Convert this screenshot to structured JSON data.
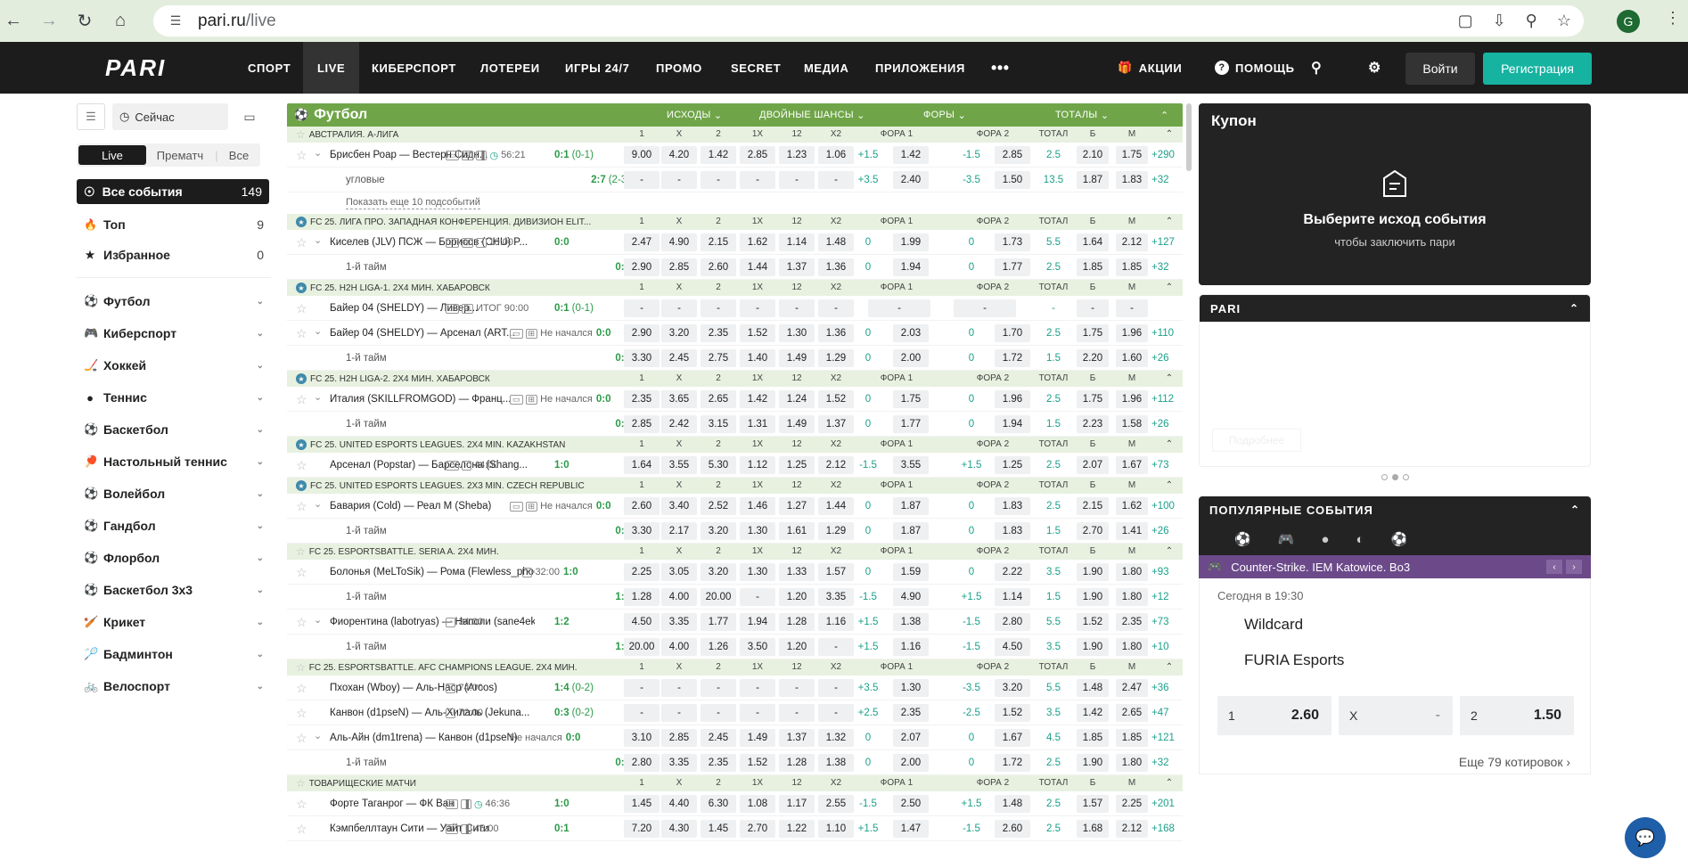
{
  "browser": {
    "url_host": "pari.ru",
    "url_path": "/live",
    "profile_initial": "G"
  },
  "nav": {
    "items": [
      "СПОРТ",
      "LIVE",
      "КИБЕРСПОРТ",
      "ЛОТЕРЕИ",
      "ИГРЫ 24/7",
      "ПРОМО",
      "SECRET",
      "МЕДИА",
      "ПРИЛОЖЕНИЯ"
    ],
    "active": "LIVE",
    "promo": "АКЦИИ",
    "help": "ПОМОЩЬ",
    "login": "Войти",
    "register": "Регистрация",
    "logo_text": "PARI"
  },
  "left": {
    "time_label": "Сейчас",
    "segments": [
      "Live",
      "Прематч",
      "Все"
    ],
    "all_events": {
      "label": "Все события",
      "count": "149"
    },
    "quick": [
      {
        "label": "Топ",
        "count": "9",
        "icon": "fire-icon"
      },
      {
        "label": "Избранное",
        "count": "0",
        "icon": "star-icon"
      }
    ],
    "sports": [
      {
        "label": "Футбол",
        "icon": "football-icon"
      },
      {
        "label": "Киберспорт",
        "icon": "gamepad-icon"
      },
      {
        "label": "Хоккей",
        "icon": "hockey-icon"
      },
      {
        "label": "Теннис",
        "icon": "tennis-icon"
      },
      {
        "label": "Баскетбол",
        "icon": "basketball-icon"
      },
      {
        "label": "Настольный теннис",
        "icon": "table-tennis-icon"
      },
      {
        "label": "Волейбол",
        "icon": "volleyball-icon"
      },
      {
        "label": "Гандбол",
        "icon": "handball-icon"
      },
      {
        "label": "Флорбол",
        "icon": "floorball-icon"
      },
      {
        "label": "Баскетбол 3x3",
        "icon": "basketball3x3-icon"
      },
      {
        "label": "Крикет",
        "icon": "cricket-icon"
      },
      {
        "label": "Бадминтон",
        "icon": "badminton-icon"
      },
      {
        "label": "Велоспорт",
        "icon": "cycling-icon"
      }
    ]
  },
  "main": {
    "sport": "Футбол",
    "markets": [
      "ИСХОДЫ",
      "ДВОЙНЫЕ ШАНСЫ",
      "ФОРЫ",
      "ТОТАЛЫ"
    ],
    "cols": [
      "1",
      "X",
      "2",
      "1X",
      "12",
      "X2",
      "ФОРА 1",
      "ФОРА 2",
      "ТОТАЛ",
      "Б",
      "М"
    ],
    "show_more": "Показать еще 10 подсобытий",
    "blocks": [
      {
        "league": "АВСТРАЛИЯ. А-ЛИГА",
        "cup": false,
        "rows": [
          {
            "type": "m",
            "exp": true,
            "name": "Брисбен Роар — Вестерн Сидн...",
            "info": "56:21",
            "clock": true,
            "icons": [
              "tv",
              "pitch",
              "stats"
            ],
            "score": "0:1",
            "ht": "(0-1)",
            "o": [
              "9.00",
              "4.20",
              "1.42",
              "2.85",
              "1.23",
              "1.06"
            ],
            "f1": "+1.5",
            "f1v": "1.42",
            "f2": "-1.5",
            "f2v": "2.85",
            "t": "2.5",
            "b": "2.10",
            "m": "1.75",
            "more": "+290"
          },
          {
            "type": "s",
            "name": "угловые",
            "score": "2:7",
            "ht": "(2-3)",
            "o": [
              "-",
              "-",
              "-",
              "-",
              "-",
              "-"
            ],
            "f1": "+3.5",
            "f1v": "2.40",
            "f2": "-3.5",
            "f2v": "1.50",
            "t": "13.5",
            "b": "1.87",
            "m": "1.83",
            "more": "+32"
          },
          {
            "type": "more"
          }
        ]
      },
      {
        "league": "FC 25. ЛИГА ПРО. ЗАПАДНАЯ КОНФЕРЕНЦИЯ. ДИВИЗИОН ELIT...",
        "cup": true,
        "rows": [
          {
            "type": "m",
            "exp": true,
            "name": "Киселев (JLV) ПСЖ — Борисов (CHU) P...",
            "info": "10:00",
            "icons": [
              "tv",
              "pitch",
              "timer"
            ],
            "score": "0:0",
            "o": [
              "2.47",
              "4.90",
              "2.15",
              "1.62",
              "1.14",
              "1.48"
            ],
            "f1": "0",
            "f1v": "1.99",
            "f2": "0",
            "f2v": "1.73",
            "t": "5.5",
            "b": "1.64",
            "m": "2.12",
            "more": "+127"
          },
          {
            "type": "s",
            "name": "1-й тайм",
            "score": "0:0",
            "o": [
              "2.90",
              "2.85",
              "2.60",
              "1.44",
              "1.37",
              "1.36"
            ],
            "f1": "0",
            "f1v": "1.94",
            "f2": "0",
            "f2v": "1.77",
            "t": "2.5",
            "b": "1.85",
            "m": "1.85",
            "more": "+32"
          }
        ]
      },
      {
        "league": "FC 25. H2H LIGA-1. 2X4 МИН. ХАБАРОВСК",
        "cup": true,
        "rows": [
          {
            "type": "m",
            "exp": false,
            "name": "Байер 04 (SHELDY) — Ливер...",
            "info": "ИТОГ  90:00",
            "icons": [
              "tv",
              "pitch"
            ],
            "score": "0:1",
            "ht": "(0-1)",
            "o": [
              "-",
              "-",
              "-",
              "-",
              "-",
              "-"
            ],
            "f1": "",
            "f1v": "-",
            "f2": "",
            "f2v": "-",
            "t": "-",
            "b": "-",
            "m": "-",
            "more": ""
          },
          {
            "type": "m",
            "exp": true,
            "name": "Байер 04 (SHELDY) — Арсенал (ART...",
            "info": "Не начался",
            "icons": [
              "tv",
              "pitch"
            ],
            "score": "0:0",
            "o": [
              "2.90",
              "3.20",
              "2.35",
              "1.52",
              "1.30",
              "1.36"
            ],
            "f1": "0",
            "f1v": "2.03",
            "f2": "0",
            "f2v": "1.70",
            "t": "2.5",
            "b": "1.75",
            "m": "1.96",
            "more": "+110"
          },
          {
            "type": "s",
            "name": "1-й тайм",
            "score": "0:0",
            "o": [
              "3.30",
              "2.45",
              "2.75",
              "1.40",
              "1.49",
              "1.29"
            ],
            "f1": "0",
            "f1v": "2.00",
            "f2": "0",
            "f2v": "1.72",
            "t": "1.5",
            "b": "2.20",
            "m": "1.60",
            "more": "+26"
          }
        ]
      },
      {
        "league": "FC 25. H2H LIGA-2. 2X4 МИН. ХАБАРОВСК",
        "cup": true,
        "rows": [
          {
            "type": "m",
            "exp": true,
            "name": "Италия (SKILLFROMGOD) — Франц...",
            "info": "Не начался",
            "icons": [
              "tv",
              "pitch"
            ],
            "score": "0:0",
            "o": [
              "2.35",
              "3.65",
              "2.65",
              "1.42",
              "1.24",
              "1.52"
            ],
            "f1": "0",
            "f1v": "1.75",
            "f2": "0",
            "f2v": "1.96",
            "t": "2.5",
            "b": "1.75",
            "m": "1.96",
            "more": "+112"
          },
          {
            "type": "s",
            "name": "1-й тайм",
            "score": "0:0",
            "o": [
              "2.85",
              "2.42",
              "3.15",
              "1.31",
              "1.49",
              "1.37"
            ],
            "f1": "0",
            "f1v": "1.77",
            "f2": "0",
            "f2v": "1.94",
            "t": "1.5",
            "b": "2.23",
            "m": "1.58",
            "more": "+26"
          }
        ]
      },
      {
        "league": "FC 25. UNITED ESPORTS LEAGUES. 2X4 MIN. KAZAKHSTAN",
        "cup": true,
        "rows": [
          {
            "type": "m",
            "exp": false,
            "name": "Арсенал (Popstar) — Барселона (Shang...",
            "info": "44:00",
            "icons": [
              "tv",
              "timer"
            ],
            "score": "1:0",
            "o": [
              "1.64",
              "3.55",
              "5.30",
              "1.12",
              "1.25",
              "2.12"
            ],
            "f1": "-1.5",
            "f1v": "3.55",
            "f2": "+1.5",
            "f2v": "1.25",
            "t": "2.5",
            "b": "2.07",
            "m": "1.67",
            "more": "+73"
          }
        ]
      },
      {
        "league": "FC 25. UNITED ESPORTS LEAGUES. 2X3 MIN. CZECH REPUBLIC",
        "cup": true,
        "rows": [
          {
            "type": "m",
            "exp": true,
            "name": "Бавария (Cold) — Реал М (Sheba)",
            "info": "Не начался",
            "icons": [
              "tv",
              "pitch"
            ],
            "score": "0:0",
            "o": [
              "2.60",
              "3.40",
              "2.52",
              "1.46",
              "1.27",
              "1.44"
            ],
            "f1": "0",
            "f1v": "1.87",
            "f2": "0",
            "f2v": "1.83",
            "t": "2.5",
            "b": "2.15",
            "m": "1.62",
            "more": "+100"
          },
          {
            "type": "s",
            "name": "1-й тайм",
            "score": "0:0",
            "o": [
              "3.30",
              "2.17",
              "3.20",
              "1.30",
              "1.61",
              "1.29"
            ],
            "f1": "0",
            "f1v": "1.87",
            "f2": "0",
            "f2v": "1.83",
            "t": "1.5",
            "b": "2.70",
            "m": "1.41",
            "more": "+26"
          }
        ]
      },
      {
        "league": "FC 25. ESPORTSBATTLE. SERIA A. 2X4 МИН.",
        "cup": false,
        "rows": [
          {
            "type": "m",
            "exp": false,
            "name": "Болонья (MeLToSik) — Рома (Flewless_phoenix)",
            "info": "32:00",
            "icons": [
              "timer"
            ],
            "score": "1:0",
            "o": [
              "2.25",
              "3.05",
              "3.20",
              "1.30",
              "1.33",
              "1.57"
            ],
            "f1": "0",
            "f1v": "1.59",
            "f2": "0",
            "f2v": "2.22",
            "t": "3.5",
            "b": "1.90",
            "m": "1.80",
            "more": "+93"
          },
          {
            "type": "s",
            "name": "1-й тайм",
            "score": "1:0",
            "o": [
              "1.28",
              "4.00",
              "20.00",
              "-",
              "1.20",
              "3.35"
            ],
            "f1": "-1.5",
            "f1v": "4.90",
            "f2": "+1.5",
            "f2v": "1.14",
            "t": "1.5",
            "b": "1.90",
            "m": "1.80",
            "more": "+12"
          },
          {
            "type": "m",
            "exp": true,
            "name": "Фиорентина (labotryas) — Наполи (sane4ek8)",
            "info": "34:00",
            "icons": [
              "timer"
            ],
            "score": "1:2",
            "o": [
              "4.50",
              "3.35",
              "1.77",
              "1.94",
              "1.28",
              "1.16"
            ],
            "f1": "+1.5",
            "f1v": "1.38",
            "f2": "-1.5",
            "f2v": "2.80",
            "t": "5.5",
            "b": "1.52",
            "m": "2.35",
            "more": "+73"
          },
          {
            "type": "s",
            "name": "1-й тайм",
            "score": "1:2",
            "o": [
              "20.00",
              "4.00",
              "1.26",
              "3.50",
              "1.20",
              "-"
            ],
            "f1": "+1.5",
            "f1v": "1.16",
            "f2": "-1.5",
            "f2v": "4.50",
            "t": "3.5",
            "b": "1.90",
            "m": "1.80",
            "more": "+10"
          }
        ]
      },
      {
        "league": "FC 25. ESPORTSBATTLE. AFC CHAMPIONS LEAGUE. 2X4 МИН.",
        "cup": false,
        "rows": [
          {
            "type": "m",
            "exp": false,
            "name": "Пхохан (Wboy) — Аль-Наср (Arcos)",
            "info": "74:00",
            "icons": [
              "timer"
            ],
            "score": "1:4",
            "ht": "(0-2)",
            "o": [
              "-",
              "-",
              "-",
              "-",
              "-",
              "-"
            ],
            "f1": "+3.5",
            "f1v": "1.30",
            "f2": "-3.5",
            "f2v": "3.20",
            "t": "5.5",
            "b": "1.48",
            "m": "2.47",
            "more": "+36"
          },
          {
            "type": "m",
            "exp": false,
            "name": "Канвон (d1pseN) — Аль-Хилаль (Jekuna...",
            "info": "72:00",
            "icons": [
              "timer"
            ],
            "score": "0:3",
            "ht": "(0-2)",
            "o": [
              "-",
              "-",
              "-",
              "-",
              "-",
              "-"
            ],
            "f1": "+2.5",
            "f1v": "2.35",
            "f2": "-2.5",
            "f2v": "1.52",
            "t": "3.5",
            "b": "1.42",
            "m": "2.65",
            "more": "+47"
          },
          {
            "type": "m",
            "exp": true,
            "name": "Аль-Айн (dm1trena) — Канвон (d1pseN)",
            "info": "Не начался",
            "icons": [],
            "score": "0:0",
            "o": [
              "3.10",
              "2.85",
              "2.45",
              "1.49",
              "1.37",
              "1.32"
            ],
            "f1": "0",
            "f1v": "2.07",
            "f2": "0",
            "f2v": "1.67",
            "t": "4.5",
            "b": "1.85",
            "m": "1.85",
            "more": "+121"
          },
          {
            "type": "s",
            "name": "1-й тайм",
            "score": "0:0",
            "o": [
              "2.80",
              "3.35",
              "2.35",
              "1.52",
              "1.28",
              "1.38"
            ],
            "f1": "0",
            "f1v": "2.00",
            "f2": "0",
            "f2v": "1.72",
            "t": "2.5",
            "b": "1.90",
            "m": "1.80",
            "more": "+32"
          }
        ]
      },
      {
        "league": "ТОВАРИЩЕСКИЕ МАТЧИ",
        "cup": false,
        "rows": [
          {
            "type": "m",
            "exp": false,
            "name": "Форте Таганрог — ФК Ван",
            "info": "46:36",
            "clock": true,
            "icons": [
              "pitch",
              "stats"
            ],
            "score": "1:0",
            "o": [
              "1.45",
              "4.40",
              "6.30",
              "1.08",
              "1.17",
              "2.55"
            ],
            "f1": "-1.5",
            "f1v": "2.50",
            "f2": "+1.5",
            "f2v": "1.48",
            "t": "2.5",
            "b": "1.57",
            "m": "2.25",
            "more": "+201"
          },
          {
            "type": "m",
            "exp": false,
            "name": "Кэмпбеллтаун Сити — Уайт Сити",
            "info": "45:00",
            "icons": [
              "pitch",
              "stats"
            ],
            "score": "0:1",
            "o": [
              "7.20",
              "4.30",
              "1.45",
              "2.70",
              "1.22",
              "1.10"
            ],
            "f1": "+1.5",
            "f1v": "1.47",
            "f2": "-1.5",
            "f2v": "2.60",
            "t": "2.5",
            "b": "1.68",
            "m": "2.12",
            "more": "+168"
          }
        ]
      }
    ]
  },
  "coupon": {
    "title": "Купон",
    "headline": "Выберите исход события",
    "sub": "чтобы заключить пари"
  },
  "pari_block": {
    "title": "PARI",
    "ghost_button": "Подробнее"
  },
  "popular": {
    "title": "ПОПУЛЯРНЫЕ СОБЫТИЯ",
    "event": "Counter-Strike. IEM Katowice. Bo3",
    "date": "Сегодня в 19:30",
    "team1": "Wildcard",
    "team2": "FURIA Esports",
    "odds": [
      {
        "label": "1",
        "value": "2.60"
      },
      {
        "label": "X",
        "value": "-"
      },
      {
        "label": "2",
        "value": "1.50"
      }
    ],
    "more": "Еще 79 котировок"
  }
}
